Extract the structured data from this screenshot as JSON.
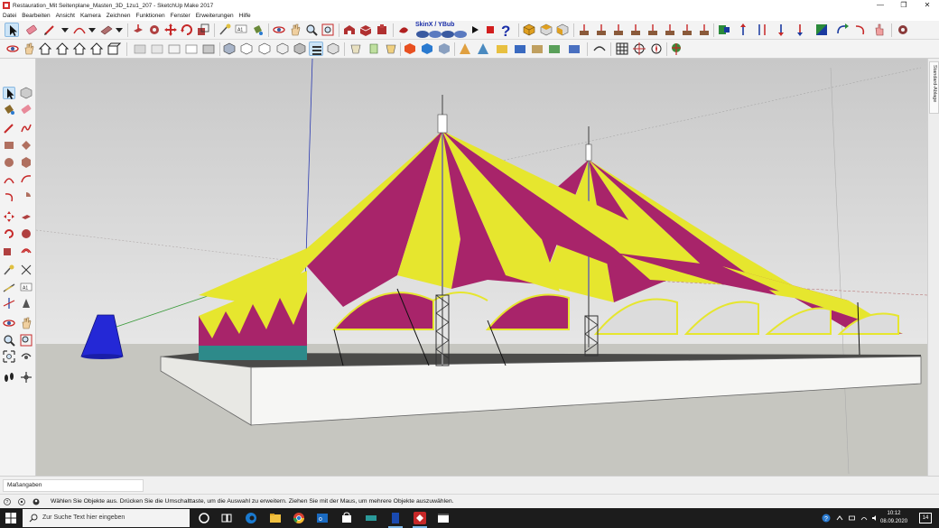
{
  "window": {
    "title": "Restauration_Mit Seitenplane_Masten_3D_1zu1_207 - SketchUp Make 2017",
    "controls": {
      "minimize": "—",
      "maximize": "❐",
      "close": "✕"
    }
  },
  "menu": [
    "Datei",
    "Bearbeiten",
    "Ansicht",
    "Kamera",
    "Zeichnen",
    "Funktionen",
    "Fenster",
    "Erweiterungen",
    "Hilfe"
  ],
  "toolbar": {
    "skinx_label": "SkinX / YBub"
  },
  "right_tray": {
    "tab_label": "Standard-Ablage"
  },
  "measurements": {
    "label": "Maßangaben",
    "value": ""
  },
  "status": {
    "message": "Wählen Sie Objekte aus. Drücken Sie die Umschalttaste, um die Auswahl zu erweitern. Ziehen Sie mit der Maus, um mehrere Objekte auszuwählen."
  },
  "taskbar": {
    "search_placeholder": "Zur Suche Text hier eingeben",
    "time": "10:12",
    "date": "08.09.2020",
    "notification_count": "14"
  },
  "colors": {
    "sky": "#d2d2d2",
    "ground": "#c6c6c0",
    "tent_magenta": "#a8246a",
    "tent_yellow": "#e6e62e",
    "tent_base_teal": "#2d8a8a",
    "platform": "#f4f4f4",
    "cone_blue": "#2428d6",
    "accent_selection": "#cce4f7"
  }
}
